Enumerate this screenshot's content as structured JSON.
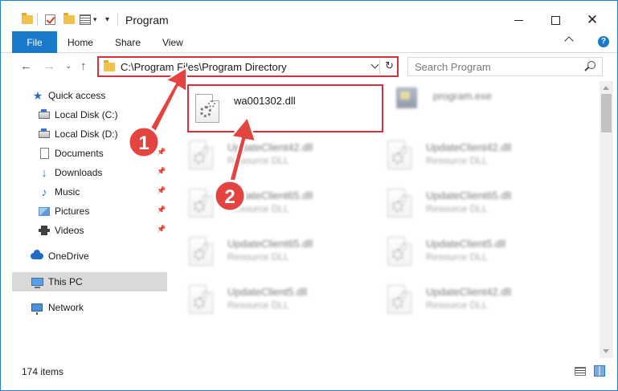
{
  "window": {
    "title": "Program",
    "accent": "#1979ca",
    "highlight_color": "#d8303a"
  },
  "ribbon": {
    "file": "File",
    "tabs": [
      "Home",
      "Share",
      "View"
    ]
  },
  "address": {
    "path": "C:\\Program Files\\Program Directory"
  },
  "search": {
    "placeholder": "Search Program"
  },
  "sidebar": {
    "items": [
      {
        "label": "Quick access",
        "icon": "star-icon"
      },
      {
        "label": "Local Disk (C:)",
        "icon": "drive-icon"
      },
      {
        "label": "Local Disk (D:)",
        "icon": "drive-icon"
      },
      {
        "label": "Documents",
        "icon": "documents-icon",
        "pinned": true
      },
      {
        "label": "Downloads",
        "icon": "downloads-icon",
        "pinned": true
      },
      {
        "label": "Music",
        "icon": "music-icon",
        "pinned": true
      },
      {
        "label": "Pictures",
        "icon": "pictures-icon",
        "pinned": true
      },
      {
        "label": "Videos",
        "icon": "videos-icon",
        "pinned": true
      },
      {
        "label": "OneDrive",
        "icon": "onedrive-icon"
      },
      {
        "label": "This PC",
        "icon": "this-pc-icon",
        "selected": true
      },
      {
        "label": "Network",
        "icon": "network-icon"
      }
    ]
  },
  "files": [
    {
      "name": "wa001302.dll",
      "type": "",
      "highlight": true
    },
    {
      "name": "program.exe",
      "type": "",
      "exe": true,
      "blurred": true
    },
    {
      "name": "UpdateClient42.dll",
      "type": "Resource DLL",
      "blurred": true
    },
    {
      "name": "UpdateClient42.dll",
      "type": "Resource DLL",
      "blurred": true
    },
    {
      "name": "UpdateClient65.dll",
      "type": "Resource DLL",
      "blurred": true
    },
    {
      "name": "UpdateClient65.dll",
      "type": "Resource DLL",
      "blurred": true
    },
    {
      "name": "UpdateClient65.dll",
      "type": "Resource DLL",
      "blurred": true
    },
    {
      "name": "UpdateClient5.dll",
      "type": "Resource DLL",
      "blurred": true
    },
    {
      "name": "UpdateClient5.dll",
      "type": "Resource DLL",
      "blurred": true
    },
    {
      "name": "UpdateClient42.dll",
      "type": "Resource DLL",
      "blurred": true
    }
  ],
  "status": {
    "count": "174 items"
  },
  "annotations": {
    "steps": [
      "1",
      "2"
    ],
    "color": "#e4443f"
  }
}
